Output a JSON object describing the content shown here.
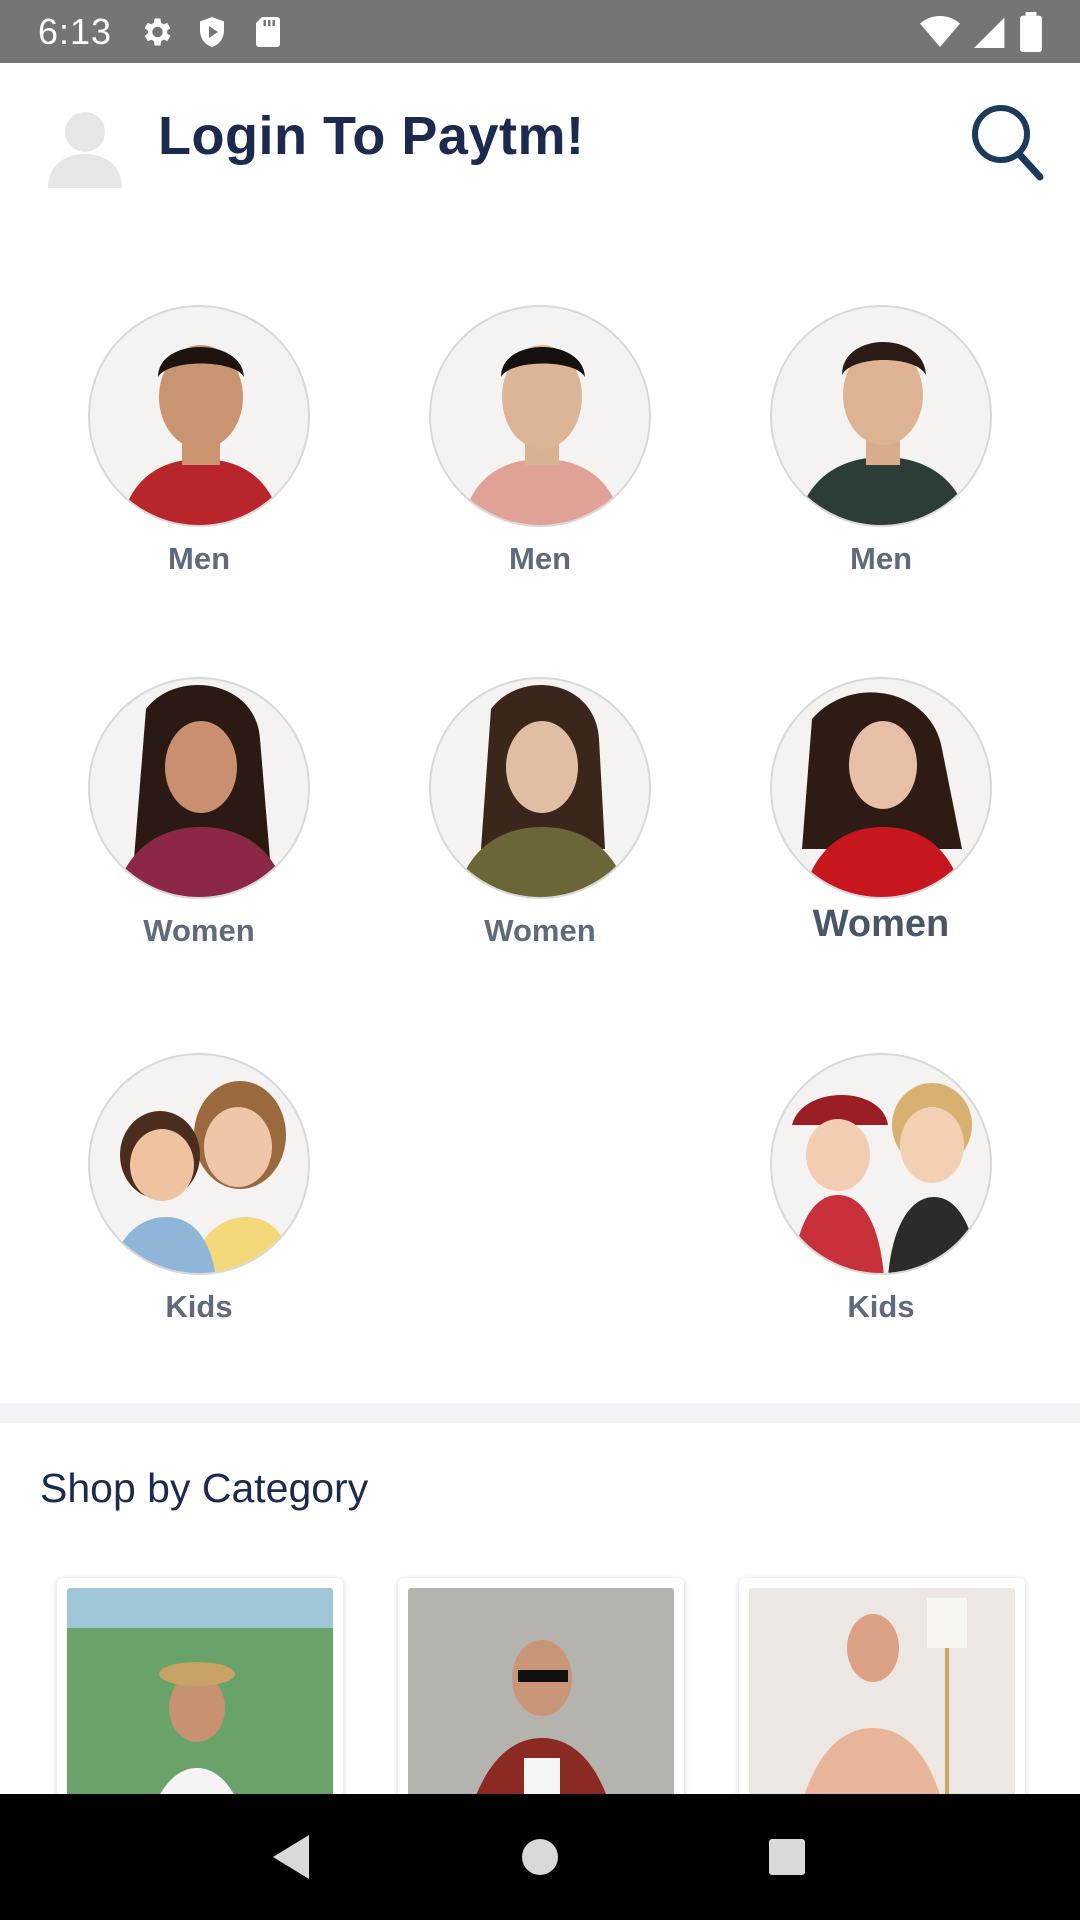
{
  "status_bar": {
    "time": "6:13",
    "icons": [
      "gear-icon",
      "shield-icon",
      "sd-card-icon"
    ],
    "right_icons": [
      "wifi-icon",
      "signal-icon",
      "battery-icon"
    ]
  },
  "header": {
    "title": "Login To Paytm!",
    "avatar_icon": "user-avatar-icon",
    "search_icon": "search-icon"
  },
  "categories": [
    {
      "label": "Men"
    },
    {
      "label": "Men"
    },
    {
      "label": "Men"
    },
    {
      "label": "Women"
    },
    {
      "label": "Women"
    },
    {
      "label": "Women"
    },
    {
      "label": "Kids"
    },
    {
      "label": "Kids"
    }
  ],
  "shop_section": {
    "title": "Shop by Category"
  },
  "nav_bar": {
    "icons": [
      "back-icon",
      "home-icon",
      "recents-icon"
    ]
  },
  "colors": {
    "brand_navy": "#1b2a4e",
    "label_gray": "#5f6a7d",
    "status_bar": "#757575"
  }
}
